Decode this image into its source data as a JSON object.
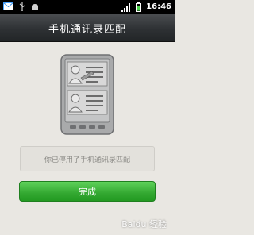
{
  "status_bar": {
    "time": "16:46",
    "icons": [
      "mail-icon",
      "usb-icon",
      "android-debug-icon",
      "signal-icon",
      "battery-icon"
    ]
  },
  "header": {
    "title": "手机通讯录匹配"
  },
  "illustration": {
    "icon": "phone-contacts-icon"
  },
  "notice": {
    "text": "你已停用了手机通讯录匹配"
  },
  "done_button": {
    "label": "完成"
  },
  "watermark": {
    "text": "Baidu 经验"
  },
  "colors": {
    "background": "#e9e7e2",
    "header": "#2e3134",
    "button": "#33a831",
    "notice_text": "#8b8a86"
  }
}
